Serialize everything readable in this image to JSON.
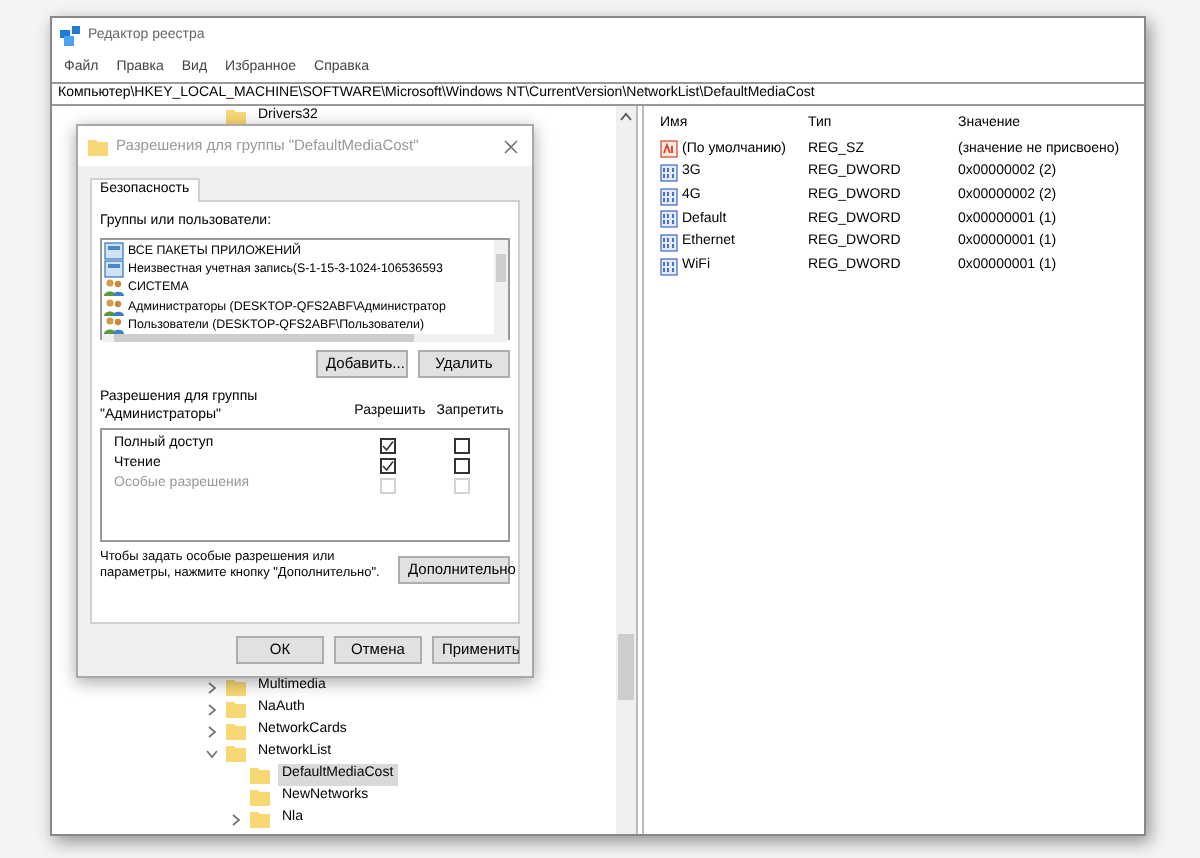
{
  "window": {
    "title": "Редактор реестра"
  },
  "menu": [
    "Файл",
    "Правка",
    "Вид",
    "Избранное",
    "Справка"
  ],
  "address_bar": "Компьютер\\HKEY_LOCAL_MACHINE\\SOFTWARE\\Microsoft\\Windows NT\\CurrentVersion\\NetworkList\\DefaultMediaCost",
  "tree": {
    "top_items": [
      {
        "name": "Drivers32",
        "selected": false
      }
    ],
    "items": [
      {
        "name": "Multimedia",
        "expanded": false,
        "selected": false
      },
      {
        "name": "NaAuth",
        "expanded": false,
        "selected": false
      },
      {
        "name": "NetworkCards",
        "expanded": false,
        "selected": false
      },
      {
        "name": "NetworkList",
        "expanded": true,
        "selected": false,
        "children": [
          {
            "name": "DefaultMediaCost",
            "selected": true
          },
          {
            "name": "NewNetworks",
            "selected": false
          },
          {
            "name": "Nla",
            "expanded": false,
            "selected": false
          }
        ]
      }
    ]
  },
  "values": {
    "columns": [
      "Имя",
      "Тип",
      "Значение"
    ],
    "rows": [
      {
        "kind": "string",
        "name": "(По умолчанию)",
        "type": "REG_SZ",
        "value": "(значение не присвоено)"
      },
      {
        "kind": "dword",
        "name": "3G",
        "type": "REG_DWORD",
        "value": "0x00000002 (2)"
      },
      {
        "kind": "dword",
        "name": "4G",
        "type": "REG_DWORD",
        "value": "0x00000002 (2)"
      },
      {
        "kind": "dword",
        "name": "Default",
        "type": "REG_DWORD",
        "value": "0x00000001 (1)"
      },
      {
        "kind": "dword",
        "name": "Ethernet",
        "type": "REG_DWORD",
        "value": "0x00000001 (1)"
      },
      {
        "kind": "dword",
        "name": "WiFi",
        "type": "REG_DWORD",
        "value": "0x00000001 (1)"
      }
    ]
  },
  "dialog": {
    "title": "Разрешения для группы \"DefaultMediaCost\"",
    "tabs": [
      {
        "label": "Безопасность",
        "selected": true
      }
    ],
    "groups_label": "Группы или пользователи:",
    "groups": [
      {
        "kind": "package",
        "name": "ВСЕ ПАКЕТЫ ПРИЛОЖЕНИЙ"
      },
      {
        "kind": "package",
        "name": "Неизвестная учетная запись(S-1-15-3-1024-106536593"
      },
      {
        "kind": "users",
        "name": "СИСТЕМА"
      },
      {
        "kind": "users",
        "name": "Администраторы (DESKTOP-QFS2ABF\\Администратор"
      },
      {
        "kind": "users",
        "name": "Пользователи (DESKTOP-QFS2ABF\\Пользователи)"
      }
    ],
    "group_buttons": [
      "Добавить...",
      "Удалить"
    ],
    "permissions_label": "Разрешения для группы\n\"Администраторы\"",
    "permission_columns": [
      "Разрешить",
      "Запретить"
    ],
    "permissions": [
      {
        "name": "Полный доступ",
        "allow": true,
        "deny": false,
        "disabled": false
      },
      {
        "name": "Чтение",
        "allow": true,
        "deny": false,
        "disabled": false
      },
      {
        "name": "Особые разрешения",
        "allow": false,
        "deny": false,
        "disabled": true
      }
    ],
    "note": "Чтобы задать особые разрешения или параметры, нажмите кнопку \"Дополнительно\".",
    "advanced_button": "Дополнительно",
    "footer_buttons": [
      "ОК",
      "Отмена",
      "Применить"
    ]
  }
}
